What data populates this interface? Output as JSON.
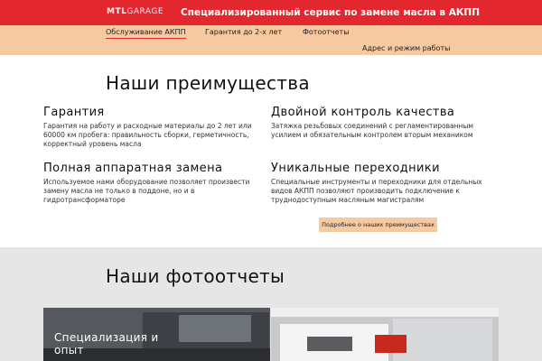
{
  "header": {
    "logo_bold": "MTL",
    "logo_thin": "GARAGE",
    "tagline": "Специализированный сервис по замене масла в АКПП"
  },
  "nav": {
    "items": [
      {
        "label": "Обслуживание АКПП",
        "active": true
      },
      {
        "label": "Гарантия до 2-х лет",
        "active": false
      },
      {
        "label": "Фотоотчеты",
        "active": false
      },
      {
        "label": "Адрес и режим работы",
        "active": false
      }
    ]
  },
  "advantages": {
    "title": "Наши преимущества",
    "items": [
      {
        "title": "Гарантия",
        "desc": "Гарантия на работу и расходные материалы до 2 лет или 60000 км пробега: правильность сборки, герметичность, корректный уровень масла"
      },
      {
        "title": "Двойной контроль качества",
        "desc": "Затяжка резьбовых соединений с регламентированным усилием и обязательным контролем вторым механиком"
      },
      {
        "title": "Полная аппаратная замена",
        "desc": "Используемое нами оборудование позволяет произвести замену масла не только в поддоне, но и в гидротрансформаторе"
      },
      {
        "title": "Уникальные переходники",
        "desc": "Специальные инструменты и переходники для отдельных видов АКПП позволяют производить подключение к труднодоступным масляным магистралям"
      }
    ],
    "more_button": "Подробнее о наших преимуществах"
  },
  "photos": {
    "title": "Наши фотоотчеты",
    "cards": [
      {
        "caption": "Специализация и опыт"
      },
      {
        "caption": ""
      }
    ]
  },
  "colors": {
    "header_red": "#e3272e",
    "nav_peach": "#f7c9a1",
    "gray_section": "#e6e6e6"
  }
}
